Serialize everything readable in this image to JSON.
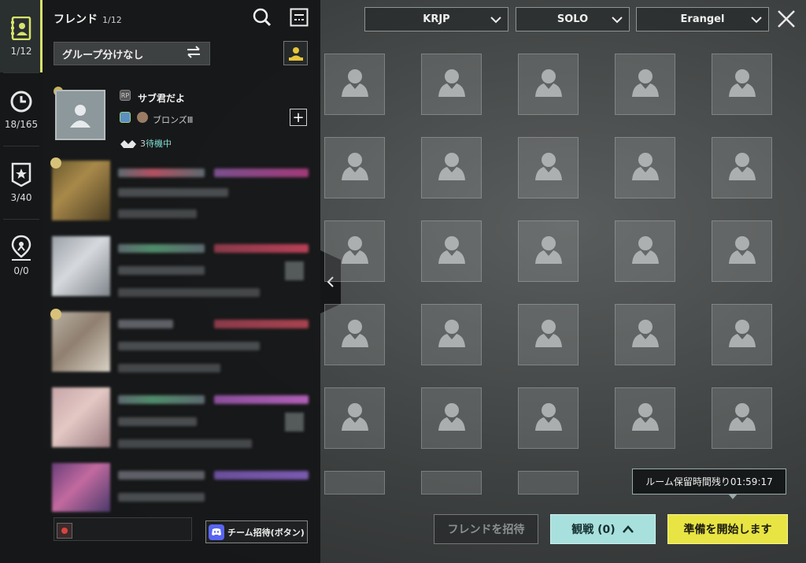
{
  "rail": {
    "items": [
      {
        "count": "1/12",
        "icon": "friends-book-icon"
      },
      {
        "count": "18/165",
        "icon": "clock-icon"
      },
      {
        "count": "3/40",
        "icon": "star-badge-icon"
      },
      {
        "count": "0/0",
        "icon": "location-pin-icon"
      }
    ]
  },
  "panel": {
    "title": "フレンド",
    "count": "1/12",
    "group_label": "グループ分けなし"
  },
  "me": {
    "name": "サブ君だよ",
    "rank": "ブロンズⅢ",
    "status": "待機中",
    "status_prefix": "3"
  },
  "friends_count": 5,
  "bottom": {
    "discord_label": "チーム招待(ボタン)"
  },
  "selectors": {
    "server": "KRJP",
    "mode": "SOLO",
    "map": "Erangel"
  },
  "room": {
    "timer_text": "ルーム保留時間残り01:59:17"
  },
  "buttons": {
    "invite": "フレンドを招待",
    "watch": "観戦 (0)",
    "start": "準備を開始します"
  },
  "colors": {
    "accent_yellow": "#e8e443",
    "accent_cyan": "#a8e0de",
    "status_cyan": "#7fe0d6"
  }
}
